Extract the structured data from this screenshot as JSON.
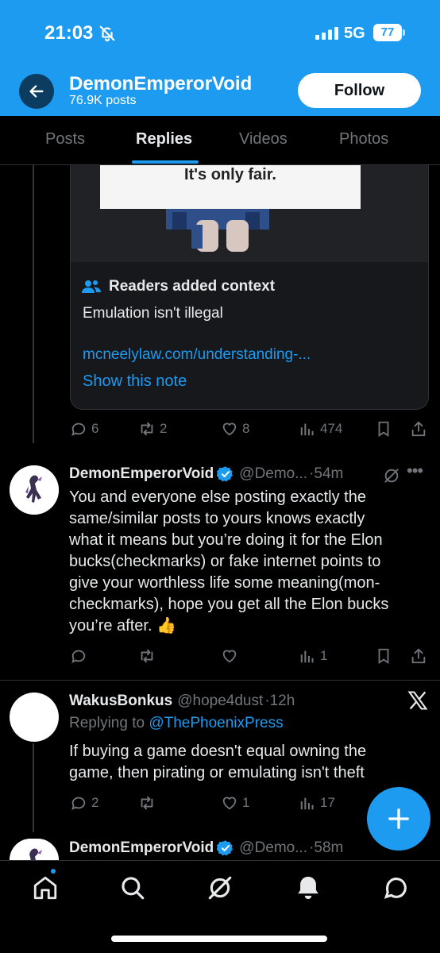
{
  "status_bar": {
    "time": "21:03",
    "network": "5G",
    "battery": "77"
  },
  "header": {
    "name": "DemonEmperorVoid",
    "post_count": "76.9K posts",
    "follow_label": "Follow"
  },
  "tabs": [
    {
      "label": "Posts"
    },
    {
      "label": "Replies"
    },
    {
      "label": "Videos"
    },
    {
      "label": "Photos"
    }
  ],
  "media": {
    "sign_text": "It's only fair."
  },
  "context_note": {
    "title": "Readers added context",
    "body": "Emulation isn't illegal",
    "link": "mcneelylaw.com/understanding-...",
    "show_label": "Show this note"
  },
  "post1_actions": {
    "replies": "6",
    "reposts": "2",
    "likes": "8",
    "views": "474"
  },
  "tweet2": {
    "name": "DemonEmperorVoid",
    "handle": "@Demo...",
    "time": "·54m",
    "lines": [
      "You and everyone else posting exactly the",
      "same/similar posts to yours knows exactly",
      "what it means but you’re doing it for the Elon",
      "bucks(checkmarks) or fake internet points to",
      "give your worthless life some meaning(mon-",
      "checkmarks), hope you get all the Elon bucks",
      "you’re after. 👍"
    ],
    "views": "1"
  },
  "tweet3": {
    "name": "WakusBonkus",
    "handle": "@hope4dust",
    "time": "·12h",
    "replying_prefix": "Replying to ",
    "replying_to": "@ThePhoenixPress",
    "lines": [
      "If buying a game doesn't equal owning the",
      "game, then pirating or emulating isn't theft"
    ],
    "replies": "2",
    "likes": "1",
    "views": "17"
  },
  "tweet4": {
    "name": "DemonEmperorVoid",
    "handle": "@Demo...",
    "time": "·58m"
  },
  "colors": {
    "accent": "#1d9bf0",
    "background": "#000000",
    "muted": "#71767b",
    "text": "#e7e9ea"
  }
}
